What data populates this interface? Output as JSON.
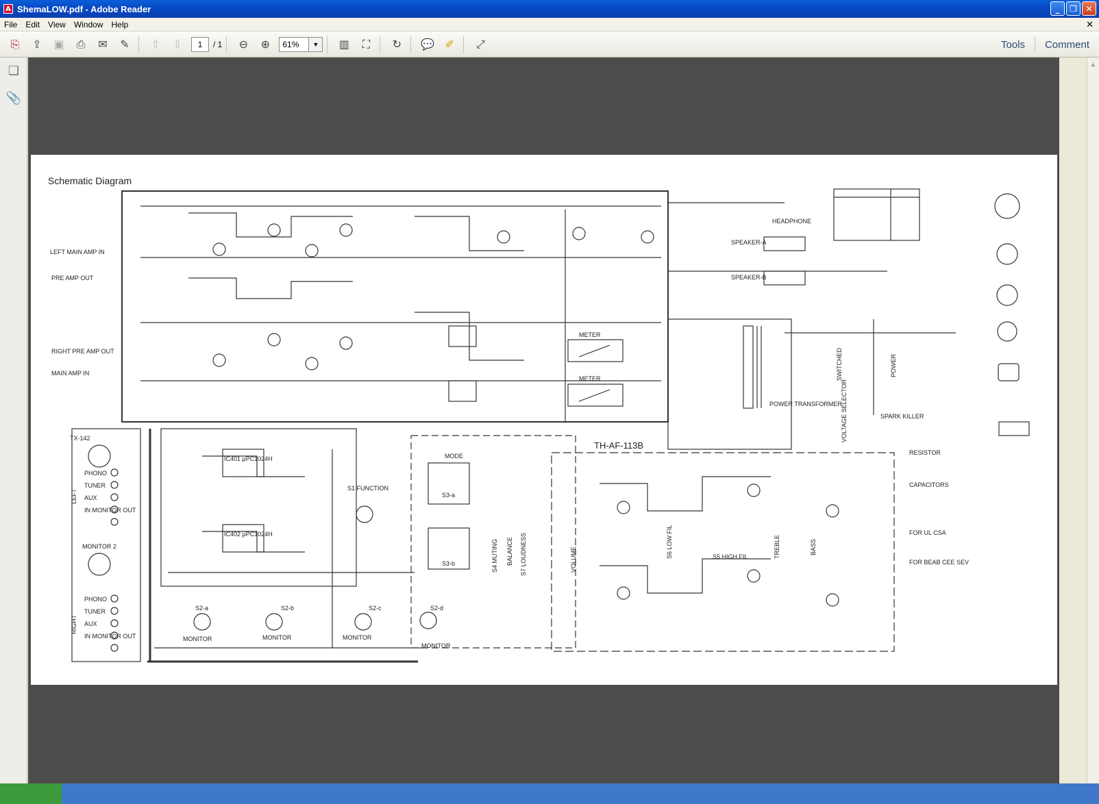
{
  "window": {
    "title": "ShemaLOW.pdf - Adobe Reader"
  },
  "menu": [
    "File",
    "Edit",
    "View",
    "Window",
    "Help"
  ],
  "toolbar": {
    "page_current": "1",
    "page_total": "/ 1",
    "zoom": "61%",
    "tools_label": "Tools",
    "comment_label": "Comment"
  },
  "schematic": {
    "title": "Schematic Diagram",
    "model": "TH-AF-113B",
    "labels": {
      "left_main_amp_in": "LEFT MAIN AMP IN",
      "pre_amp_out": "PRE AMP OUT",
      "right_pre_amp_out": "RIGHT PRE AMP OUT",
      "main_amp_in": "MAIN AMP IN",
      "headphone": "HEADPHONE",
      "speaker_a": "SPEAKER-A",
      "speaker_b": "SPEAKER-B",
      "meter": "METER",
      "power_transformer": "POWER TRANSFORMER",
      "power": "POWER",
      "voltage_selector": "VOLTAGE SELECTOR",
      "switched": "SWITCHED",
      "spark_killer": "SPARK KILLER",
      "tx142": "TX-142",
      "phono": "PHONO",
      "tuner": "TUNER",
      "aux": "AUX",
      "in_monitor_out": "IN MONITOR OUT",
      "monitor2": "MONITOR 2",
      "left": "LEFT",
      "right": "RIGHT",
      "mode": "MODE",
      "function": "S1 FUNCTION",
      "muting": "S4 MUTING",
      "balance": "BALANCE",
      "loudness": "S7 LOUDNESS",
      "volume": "VOLUME",
      "low_fil": "S6 LOW FIL",
      "high_fil": "S5 HIGH FIL",
      "treble": "TREBLE",
      "bass": "BASS",
      "monitor": "MONITOR",
      "s2a": "S2-a",
      "s2b": "S2-b",
      "s2c": "S2-c",
      "s2d": "S2-d",
      "s3a": "S3-a",
      "s3b": "S3-b",
      "ic401": "IC401 μPC1024H",
      "ic402": "IC402 μPC1024H"
    },
    "notes": {
      "resistor": "RESISTOR",
      "capacitors": "CAPACITORS",
      "for_ul_csa": "FOR UL CSA",
      "for_beab": "FOR BEAB CEE SEV"
    }
  }
}
